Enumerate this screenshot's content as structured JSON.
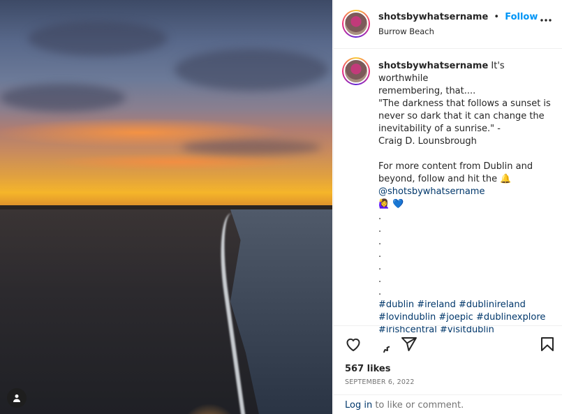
{
  "post": {
    "username": "shotsbywhatsername",
    "separator": "•",
    "follow_label": "Follow",
    "location": "Burrow Beach",
    "more_icon": "more-horizontal-icon",
    "caption_lines": [
      "It's worthwhile",
      "remembering, that....",
      "\"The darkness that follows a sunset is",
      "never so dark that it can change the",
      "inevitability of a sunrise.\" -",
      "Craig D. Lounsbrough",
      "",
      "For more content from Dublin and",
      "beyond, follow and hit the 🔔"
    ],
    "mention": "@shotsbywhatsername",
    "emojis": "🙋‍♀️ 💙",
    "dots": [
      ".",
      ".",
      ".",
      ".",
      ".",
      ".",
      "."
    ],
    "hashtag_lines": [
      "#dublin #ireland #dublinireland",
      "#lovindublin #joepic #dublinexplore",
      "#irishcentral #visitdublin"
    ],
    "likes": "567 likes",
    "date": "SEPTEMBER 6, 2022",
    "login_link": "Log in",
    "login_rest": " to like or comment."
  },
  "colors": {
    "follow": "#0095f6",
    "link": "#00376b",
    "text": "#262626",
    "muted": "#737373"
  }
}
